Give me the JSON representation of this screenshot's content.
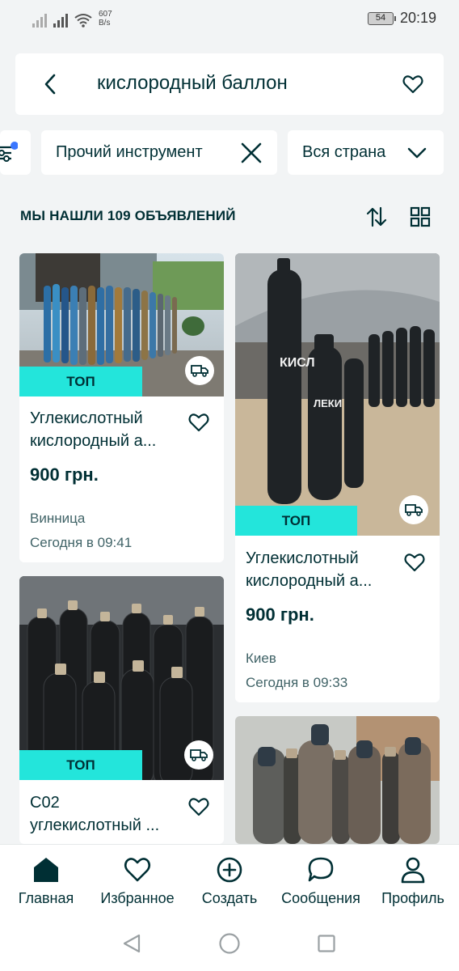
{
  "status_bar": {
    "net_speed_value": "607",
    "net_speed_unit": "B/s",
    "battery": "54",
    "time": "20:19"
  },
  "search": {
    "query": "кислородный баллон"
  },
  "filters": {
    "category": "Прочий инструмент",
    "region": "Вся страна"
  },
  "results": {
    "count_label": "МЫ НАШЛИ 109 ОБЪЯВЛЕНИЙ"
  },
  "listings": [
    {
      "badge": "ТОП",
      "title": "Углекислотный\nкислородный а...",
      "price": "900 грн.",
      "city": "Винница",
      "date": "Сегодня в 09:41"
    },
    {
      "badge": "ТОП",
      "title": "Углекислотный\nкислородный а...",
      "price": "900 грн.",
      "city": "Киев",
      "date": "Сегодня в 09:33"
    },
    {
      "badge": "ТОП",
      "title": "С02\nуглекислотный ...",
      "price": "",
      "city": "",
      "date": ""
    },
    {
      "badge": "",
      "title": "",
      "price": "",
      "city": "",
      "date": ""
    }
  ],
  "bottom_nav": [
    {
      "label": "Главная",
      "icon": "home-icon",
      "active": true
    },
    {
      "label": "Избранное",
      "icon": "heart-icon"
    },
    {
      "label": "Создать",
      "icon": "plus-circle-icon"
    },
    {
      "label": "Сообщения",
      "icon": "chat-icon"
    },
    {
      "label": "Профиль",
      "icon": "person-icon"
    }
  ],
  "colors": {
    "accent": "#23e5db",
    "text": "#002f34",
    "background": "#f2f4f5",
    "filter_dot": "#3a77ff"
  }
}
